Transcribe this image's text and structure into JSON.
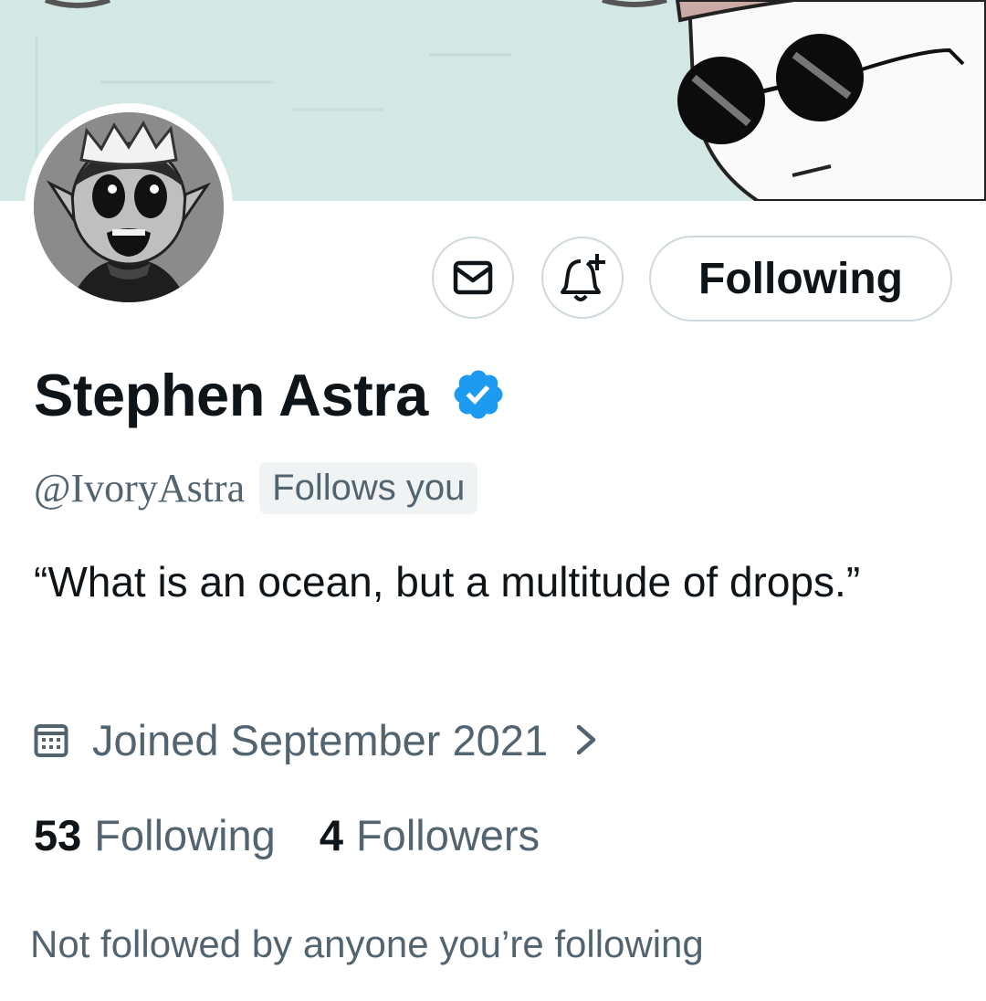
{
  "profile": {
    "display_name": "Stephen Astra",
    "verified_icon": "verified-badge-icon",
    "handle": "@IvoryAstra",
    "follows_you_badge": "Follows you",
    "bio": "“What is an ocean, but a multitude of drops.”",
    "joined": "Joined September 2021",
    "following_count": "53",
    "following_label": "Following",
    "followers_count": "4",
    "followers_label": "Followers",
    "mutuals_text": "Not followed by anyone you’re following"
  },
  "actions": {
    "message_icon": "envelope-icon",
    "notify_icon": "bell-plus-icon",
    "follow_button_label": "Following"
  },
  "colors": {
    "verified_blue": "#1d9bf0",
    "secondary_text": "#536471",
    "primary_text": "#0f1419",
    "button_border": "#cfd9de",
    "banner_bg": "#d3e7e4"
  }
}
